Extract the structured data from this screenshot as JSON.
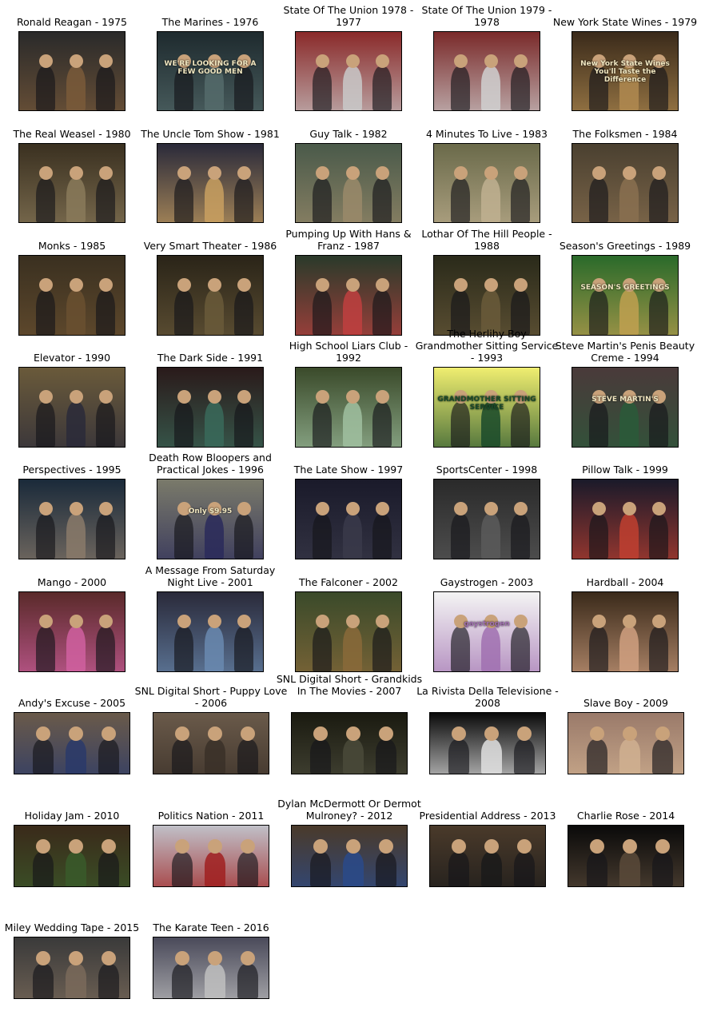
{
  "tiles": [
    {
      "title": "Ronald Reagan - 1975",
      "bg": "#2a2a2a",
      "accent": "#7a5a3a"
    },
    {
      "title": "The Marines - 1976",
      "bg": "#1e2a2e",
      "accent": "#556b6b",
      "caption": "WE'RE LOOKING FOR A FEW GOOD MEN"
    },
    {
      "title": "State Of The Union 1978 - 1977",
      "bg": "#8a2a2a",
      "accent": "#c9c9c9"
    },
    {
      "title": "State Of The Union 1979 - 1978",
      "bg": "#7a2a2a",
      "accent": "#d0d0d0"
    },
    {
      "title": "New York State Wines - 1979",
      "bg": "#3a2a1a",
      "accent": "#b08a50",
      "caption": "New York State Wines You'll Taste the Difference"
    },
    {
      "title": "The Real Weasel - 1980",
      "bg": "#3a3020",
      "accent": "#8a7a5a"
    },
    {
      "title": "The Uncle Tom Show - 1981",
      "bg": "#2a2a3a",
      "accent": "#c9a060"
    },
    {
      "title": "Guy Talk - 1982",
      "bg": "#4a5a4a",
      "accent": "#9a8a6a"
    },
    {
      "title": "4 Minutes To Live - 1983",
      "bg": "#6a6a4a",
      "accent": "#c0b090"
    },
    {
      "title": "The Folksmen - 1984",
      "bg": "#4a4030",
      "accent": "#8a7050"
    },
    {
      "title": "Monks - 1985",
      "bg": "#3a3020",
      "accent": "#6a5030"
    },
    {
      "title": "Very Smart Theater - 1986",
      "bg": "#2a2418",
      "accent": "#6a5a3a"
    },
    {
      "title": "Pumping Up With Hans & Franz - 1987",
      "bg": "#2a3a2a",
      "accent": "#c04040"
    },
    {
      "title": "Lothar Of The Hill People - 1988",
      "bg": "#2a2a1a",
      "accent": "#6a5a3a"
    },
    {
      "title": "Season's Greetings - 1989",
      "bg": "#2a6a2a",
      "accent": "#c0a050",
      "caption": "SEASON'S GREETINGS"
    },
    {
      "title": "Elevator - 1990",
      "bg": "#6a5a3a",
      "accent": "#2a2a3a"
    },
    {
      "title": "The Dark Side - 1991",
      "bg": "#2a1a1a",
      "accent": "#3a6a5a"
    },
    {
      "title": "High School Liars Club - 1992",
      "bg": "#3a4a2a",
      "accent": "#a0c0a0"
    },
    {
      "title": "The Herlihy Boy Grandmother Sitting Service - 1993",
      "bg": "#f0ee70",
      "accent": "#1a4a2a",
      "caption": "GRANDMOTHER SITTING SERVICE"
    },
    {
      "title": "Steve Martin's Penis Beauty Creme - 1994",
      "bg": "#4a3a3a",
      "accent": "#2a5a3a",
      "caption": "STEVE MARTIN'S"
    },
    {
      "title": "Perspectives - 1995",
      "bg": "#1a2a3a",
      "accent": "#8a7a6a"
    },
    {
      "title": "Death Row Bloopers and Practical Jokes - 1996",
      "bg": "#7a7a6a",
      "accent": "#2a2a5a",
      "caption": "Only $9.95"
    },
    {
      "title": "The Late Show - 1997",
      "bg": "#1a1a2a",
      "accent": "#3a3a4a"
    },
    {
      "title": "SportsCenter - 1998",
      "bg": "#2a2a2a",
      "accent": "#5a5a5a"
    },
    {
      "title": "Pillow Talk - 1999",
      "bg": "#1a1a2a",
      "accent": "#c04030"
    },
    {
      "title": "Mango - 2000",
      "bg": "#5a2a2a",
      "accent": "#d060a0"
    },
    {
      "title": "A Message From Saturday Night Live - 2001",
      "bg": "#2a2a3a",
      "accent": "#6a8ab0"
    },
    {
      "title": "The Falconer - 2002",
      "bg": "#3a4a2a",
      "accent": "#8a6a3a"
    },
    {
      "title": "Gaystrogen - 2003",
      "bg": "#f4f4f4",
      "accent": "#a070b0",
      "caption": "gaystrogen"
    },
    {
      "title": "Hardball - 2004",
      "bg": "#3a2a1a",
      "accent": "#d0a080"
    },
    {
      "title": "Andy's Excuse - 2005",
      "bg": "#6a5a4a",
      "accent": "#2a3a6a"
    },
    {
      "title": "SNL Digital Short - Puppy Love - 2006",
      "bg": "#6a5a4a",
      "accent": "#3a3028"
    },
    {
      "title": "SNL Digital Short - Grandkids In The Movies - 2007",
      "bg": "#1a1a10",
      "accent": "#4a4a3a"
    },
    {
      "title": "La Rivista Della Televisione - 2008",
      "bg": "#0a0a0a",
      "accent": "#e0e0e0"
    },
    {
      "title": "Slave Boy - 2009",
      "bg": "#9a7a6a",
      "accent": "#d0b090"
    },
    {
      "title": "Holiday Jam - 2010",
      "bg": "#3a2a1a",
      "accent": "#3a5a2a"
    },
    {
      "title": "Politics Nation - 2011",
      "bg": "#c0c0c8",
      "accent": "#a02020"
    },
    {
      "title": "Dylan McDermott Or Dermot Mulroney? - 2012",
      "bg": "#4a3a2a",
      "accent": "#2a4a8a"
    },
    {
      "title": "Presidential Address - 2013",
      "bg": "#4a3a2a",
      "accent": "#1a1a1a"
    },
    {
      "title": "Charlie Rose - 2014",
      "bg": "#0a0a0a",
      "accent": "#5a4a3a"
    },
    {
      "title": "Miley Wedding Tape - 2015",
      "bg": "#3a3a3a",
      "accent": "#7a6a5a"
    },
    {
      "title": "The Karate Teen - 2016",
      "bg": "#4a4a5a",
      "accent": "#c0c0c0"
    }
  ]
}
